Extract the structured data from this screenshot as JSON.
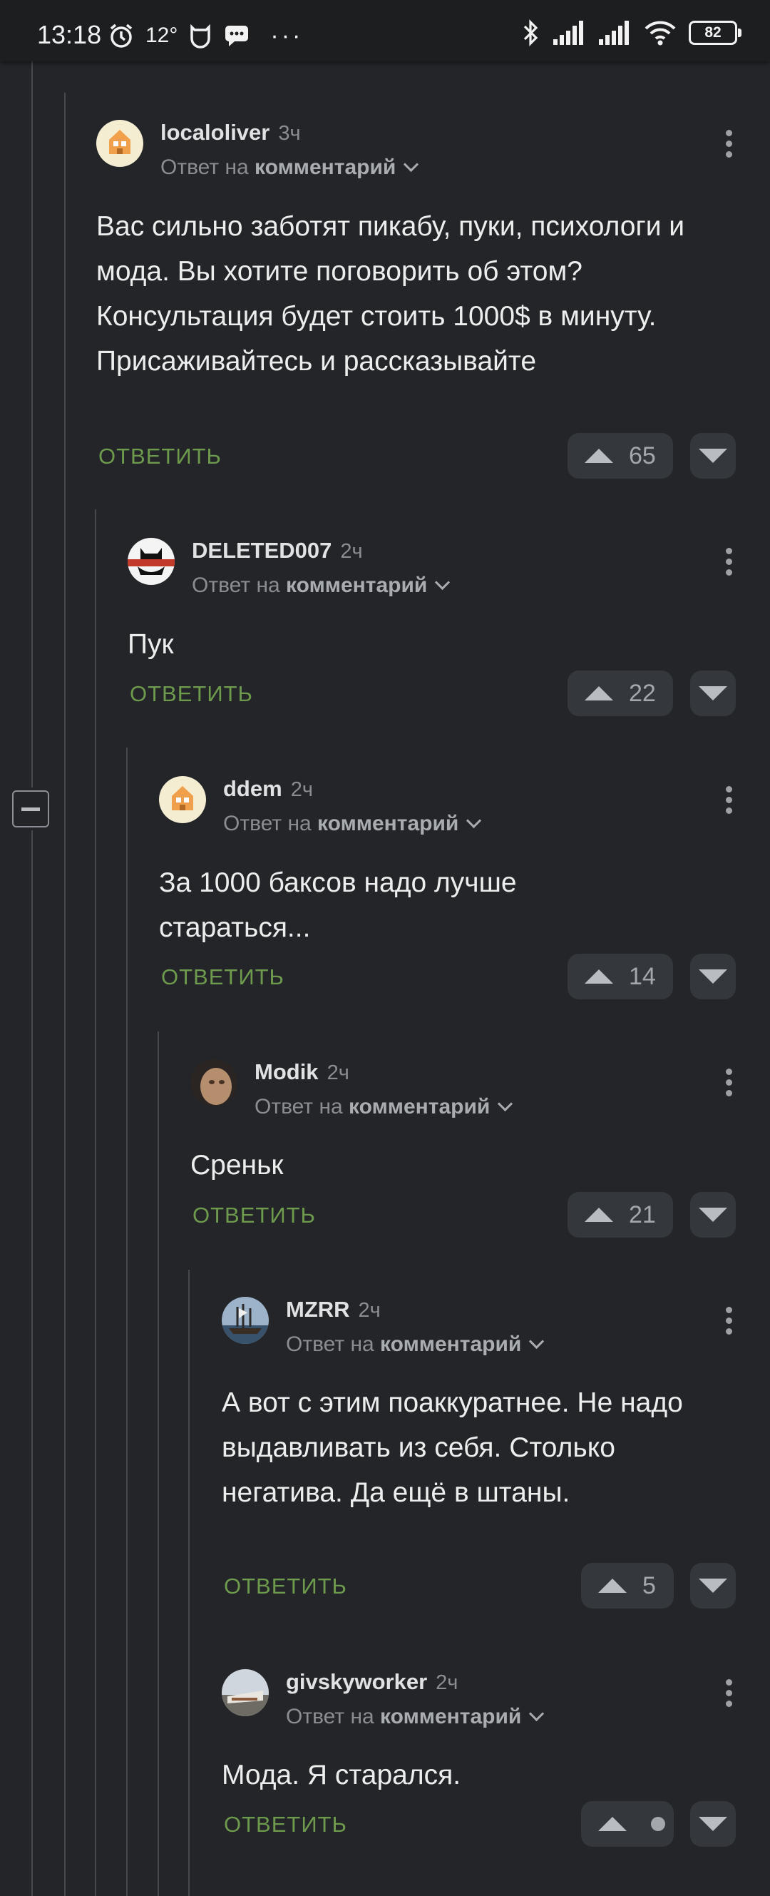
{
  "statusbar": {
    "time": "13:18",
    "temperature": "12°",
    "more": "···",
    "battery": "82",
    "icons": [
      "alarm-icon",
      "mi-icon",
      "message-icon",
      "bluetooth-icon",
      "signal-icon",
      "signal-icon",
      "wifi-icon",
      "battery-icon"
    ]
  },
  "reply_to_prefix": "Ответ на",
  "reply_to_target": "комментарий",
  "reply_label": "ОТВЕТИТЬ",
  "comments": [
    {
      "author": "localoliver",
      "time": "3ч",
      "text": "Вас сильно заботят пикабу, пуки, психологи и мода. Вы хотите поговорить об этом? Консультация будет стоить 1000$ в минуту. Присаживайтесь и рассказывайте",
      "votes": "65"
    },
    {
      "author": "DELETED007",
      "time": "2ч",
      "text": "Пук",
      "votes": "22"
    },
    {
      "author": "ddem",
      "time": "2ч",
      "text": "За 1000 баксов надо лучше стараться...",
      "votes": "14"
    },
    {
      "author": "Modik",
      "time": "2ч",
      "text": "Среньк",
      "votes": "21"
    },
    {
      "author": "MZRR",
      "time": "2ч",
      "text": "А вот с этим поаккуратнее. Не надо выдавливать из себя. Столько негатива. Да ещё в штаны.",
      "votes": "5"
    },
    {
      "author": "givskyworker",
      "time": "2ч",
      "text": "Мода. Я старался.",
      "votes": ""
    }
  ]
}
